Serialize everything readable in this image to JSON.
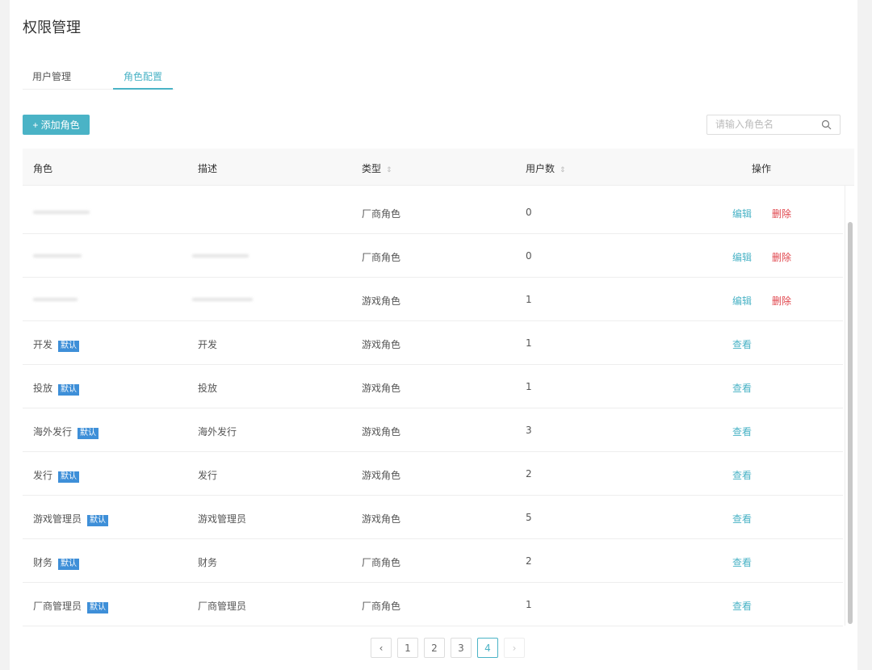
{
  "page": {
    "title": "权限管理"
  },
  "tabs": [
    {
      "label": "用户管理"
    },
    {
      "label": "角色配置"
    }
  ],
  "toolbar": {
    "add_label": "+ 添加角色",
    "search_placeholder": "请输入角色名"
  },
  "table": {
    "headers": {
      "role": "角色",
      "desc": "描述",
      "type": "类型",
      "users": "用户数",
      "actions": "操作"
    },
    "rows": [
      {
        "role": "",
        "desc": "",
        "type": "厂商角色",
        "users": "0",
        "editable": true
      },
      {
        "role": "",
        "desc": "",
        "type": "厂商角色",
        "users": "0",
        "editable": true
      },
      {
        "role": "",
        "desc": "",
        "type": "游戏角色",
        "users": "1",
        "editable": true
      },
      {
        "role": "开发",
        "badge": "默认",
        "desc": "开发",
        "type": "游戏角色",
        "users": "1"
      },
      {
        "role": "投放",
        "badge": "默认",
        "desc": "投放",
        "type": "游戏角色",
        "users": "1"
      },
      {
        "role": "海外发行",
        "badge": "默认",
        "desc": "海外发行",
        "type": "游戏角色",
        "users": "3"
      },
      {
        "role": "发行",
        "badge": "默认",
        "desc": "发行",
        "type": "游戏角色",
        "users": "2"
      },
      {
        "role": "游戏管理员",
        "badge": "默认",
        "desc": "游戏管理员",
        "type": "游戏角色",
        "users": "5"
      },
      {
        "role": "财务",
        "badge": "默认",
        "desc": "财务",
        "type": "厂商角色",
        "users": "2"
      },
      {
        "role": "厂商管理员",
        "badge": "默认",
        "desc": "厂商管理员",
        "type": "厂商角色",
        "users": "1"
      }
    ],
    "actions": {
      "edit": "编辑",
      "delete": "删除",
      "view": "查看"
    }
  },
  "pagination": {
    "pages": [
      "1",
      "2",
      "3",
      "4"
    ],
    "current": "4"
  },
  "colors": {
    "accent": "#4ab3c6",
    "danger": "#e0454c",
    "badge": "#3e8fd8"
  }
}
